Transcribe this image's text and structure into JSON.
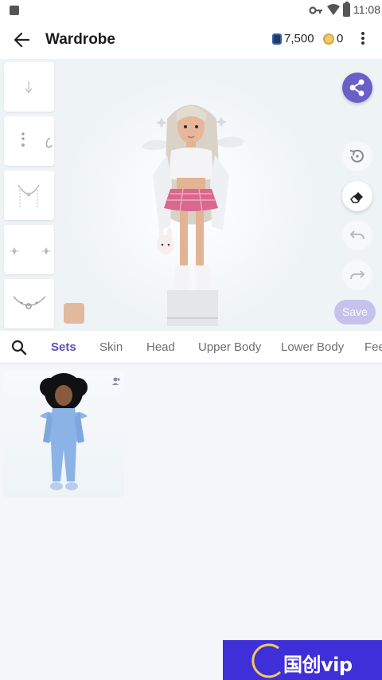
{
  "status_bar": {
    "time": "11:08"
  },
  "app_bar": {
    "title": "Wardrobe",
    "gems": "7,500",
    "coins": "0"
  },
  "stage": {
    "save_label": "Save",
    "skin_color": "#e2b99c"
  },
  "tabs": [
    "Sets",
    "Skin",
    "Head",
    "Upper Body",
    "Lower Body",
    "Feet"
  ],
  "colors": {
    "accent": "#5a4fc0",
    "share": "#6a5ec8",
    "save_disabled": "#c5c2ec"
  },
  "banner": {
    "text": "国创vip"
  }
}
